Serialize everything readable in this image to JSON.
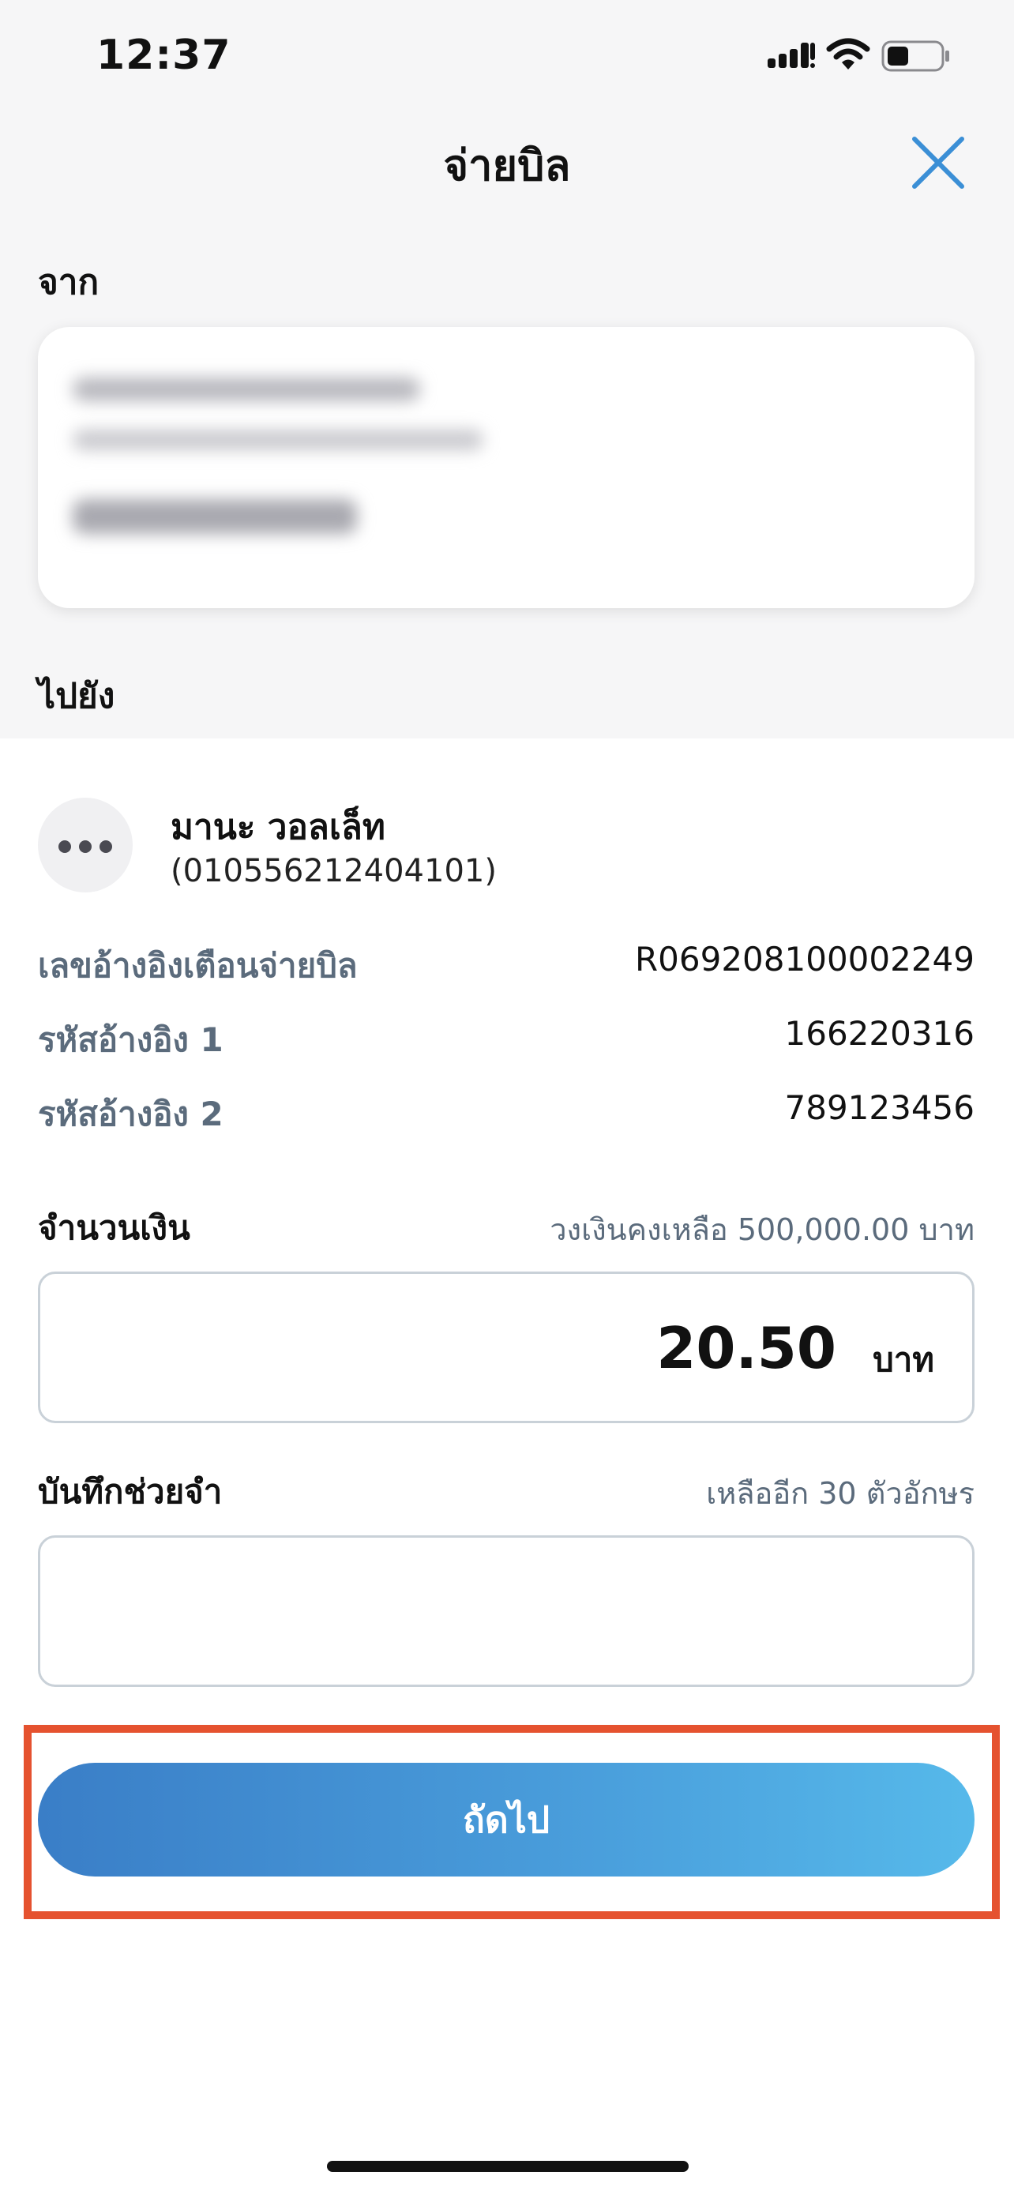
{
  "status_bar": {
    "time": "12:37"
  },
  "header": {
    "title": "จ่ายบิล"
  },
  "from_section": {
    "label": "จาก"
  },
  "to_section": {
    "label": "ไปยัง",
    "biller_name": "มานะ  วอลเล็ท",
    "biller_id": "(010556212404101)"
  },
  "details": [
    {
      "label": "เลขอ้างอิงเตือนจ่ายบิล",
      "value": "R069208100002249"
    },
    {
      "label": "รหัสอ้างอิง 1",
      "value": "166220316"
    },
    {
      "label": "รหัสอ้างอิง 2",
      "value": "789123456"
    }
  ],
  "amount": {
    "label": "จำนวนเงิน",
    "limit_hint": "วงเงินคงเหลือ 500,000.00 บาท",
    "value": "20.50",
    "unit": "บาท"
  },
  "note": {
    "label": "บันทึกช่วยจำ",
    "remaining_hint": "เหลืออีก 30 ตัวอักษร",
    "value": ""
  },
  "actions": {
    "next_label": "ถัดไป"
  },
  "colors": {
    "accent_start": "#3a7ec7",
    "accent_end": "#56b9ea",
    "highlight": "#e5522f",
    "close_icon": "#3b8fd6"
  },
  "icons": [
    "signal-icon",
    "wifi-icon",
    "battery-icon",
    "close-icon",
    "more-dots-icon"
  ]
}
